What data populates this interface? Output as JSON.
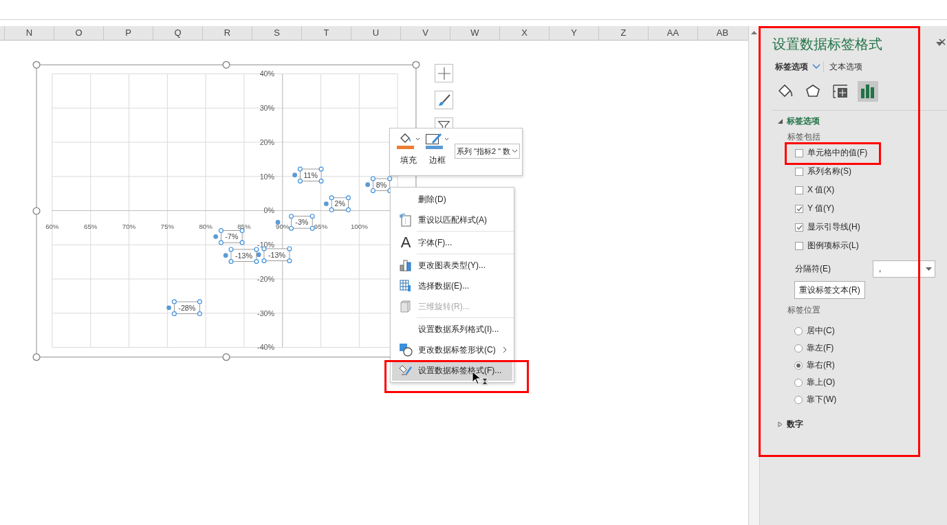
{
  "column_headers": [
    "N",
    "O",
    "P",
    "Q",
    "R",
    "S",
    "T",
    "U",
    "V",
    "W",
    "X",
    "Y",
    "Z",
    "AA",
    "AB"
  ],
  "chart": {
    "selected": true,
    "side_buttons": [
      {
        "kind": "add"
      },
      {
        "kind": "style"
      },
      {
        "kind": "filter"
      }
    ],
    "chart_data": {
      "type": "scatter",
      "grid": true,
      "xlim": [
        0.6,
        1.05
      ],
      "ylim": [
        -0.4,
        0.4
      ],
      "xticks": [
        {
          "value": 0.6,
          "label": "60%"
        },
        {
          "value": 0.65,
          "label": "65%"
        },
        {
          "value": 0.7,
          "label": "70%"
        },
        {
          "value": 0.75,
          "label": "75%"
        },
        {
          "value": 0.8,
          "label": "80%"
        },
        {
          "value": 0.85,
          "label": "85%"
        },
        {
          "value": 0.9,
          "label": "90%"
        },
        {
          "value": 0.95,
          "label": "95%"
        },
        {
          "value": 1.0,
          "label": "100%"
        }
      ],
      "yticks": [
        {
          "value": 0.4,
          "label": "40%"
        },
        {
          "value": 0.3,
          "label": "30%"
        },
        {
          "value": 0.2,
          "label": "20%"
        },
        {
          "value": 0.1,
          "label": "10%"
        },
        {
          "value": 0,
          "label": "0%"
        },
        {
          "value": -0.1,
          "label": "-10%"
        },
        {
          "value": -0.2,
          "label": "-20%"
        },
        {
          "value": -0.3,
          "label": "-30%"
        },
        {
          "value": -0.4,
          "label": "-40%"
        }
      ],
      "series": [
        {
          "color": "#5b9bd5",
          "x": [
            0.916,
            1.011,
            0.957,
            0.894,
            0.813,
            0.826,
            0.869,
            0.752
          ],
          "values": [
            0.104,
            0.076,
            0.02,
            -0.034,
            -0.076,
            -0.131,
            -0.129,
            -0.284
          ]
        }
      ],
      "value_labels": [
        "11%",
        "8%",
        "2%",
        "-3%",
        "-7%",
        "-13%",
        "-13%",
        "-28%"
      ]
    }
  },
  "mini_toolbar": {
    "buttons": [
      {
        "label": "填充",
        "kind": "fill"
      },
      {
        "label": "边框",
        "kind": "border"
      }
    ],
    "element_select": "系列 \"指标2 \" 数"
  },
  "context_menu": {
    "items": [
      {
        "label": "删除(D)",
        "disabled": false,
        "selected": false,
        "separator_before": false,
        "submenu": false,
        "highlighted": false
      },
      {
        "label": "重设以匹配样式(A)",
        "disabled": false,
        "selected": false,
        "separator_before": false,
        "submenu": false,
        "highlighted": false
      },
      {
        "label": "字体(F)...",
        "icon_glyph": "A",
        "disabled": false,
        "selected": false,
        "separator_before": true,
        "submenu": false,
        "highlighted": false
      },
      {
        "label": "更改图表类型(Y)...",
        "disabled": false,
        "selected": false,
        "separator_before": true,
        "submenu": false,
        "highlighted": false
      },
      {
        "label": "选择数据(E)...",
        "disabled": false,
        "selected": false,
        "separator_before": false,
        "submenu": false,
        "highlighted": false
      },
      {
        "label": "三维旋转(R)...",
        "disabled": true,
        "selected": false,
        "separator_before": false,
        "submenu": false,
        "highlighted": false
      },
      {
        "label": "设置数据系列格式(I)...",
        "disabled": false,
        "selected": false,
        "separator_before": true,
        "submenu": false,
        "highlighted": false
      },
      {
        "label": "更改数据标签形状(C)",
        "disabled": false,
        "selected": false,
        "separator_before": false,
        "submenu": true,
        "highlighted": false
      },
      {
        "label": "设置数据标签格式(F)...",
        "disabled": false,
        "selected": true,
        "separator_before": false,
        "submenu": false,
        "highlighted": true
      }
    ]
  },
  "format_pane": {
    "title": "设置数据标签格式",
    "highlighted": true,
    "tabs": [
      {
        "label": "标签选项",
        "selected": true
      },
      {
        "label": "文本选项",
        "selected": false
      }
    ],
    "icon_tabs": [
      {
        "kind": "fill",
        "selected": false
      },
      {
        "kind": "effects",
        "selected": false
      },
      {
        "kind": "size",
        "selected": false
      },
      {
        "kind": "options",
        "selected": true
      }
    ],
    "label_options": {
      "title": "标签选项",
      "expanded": true,
      "contains_heading": "标签包括",
      "checkboxes": [
        {
          "label": "单元格中的值(F)",
          "checked": false,
          "highlighted": true
        },
        {
          "label": "系列名称(S)",
          "checked": false,
          "highlighted": false
        },
        {
          "label": "X 值(X)",
          "checked": false,
          "highlighted": false
        },
        {
          "label": "Y 值(Y)",
          "checked": true,
          "highlighted": false
        },
        {
          "label": "显示引导线(H)",
          "checked": true,
          "highlighted": false
        },
        {
          "label": "图例项标示(L)",
          "checked": false,
          "highlighted": false
        }
      ],
      "separator": {
        "label": "分隔符(E)",
        "value": ","
      },
      "reset_button": "重设标签文本(R)",
      "position_heading": "标签位置",
      "positions": [
        {
          "label": "居中(C)",
          "selected": false
        },
        {
          "label": "靠左(F)",
          "selected": false
        },
        {
          "label": "靠右(R)",
          "selected": true
        },
        {
          "label": "靠上(O)",
          "selected": false
        },
        {
          "label": "靠下(W)",
          "selected": false
        }
      ]
    },
    "number_section": {
      "title": "数字",
      "expanded": false
    }
  }
}
